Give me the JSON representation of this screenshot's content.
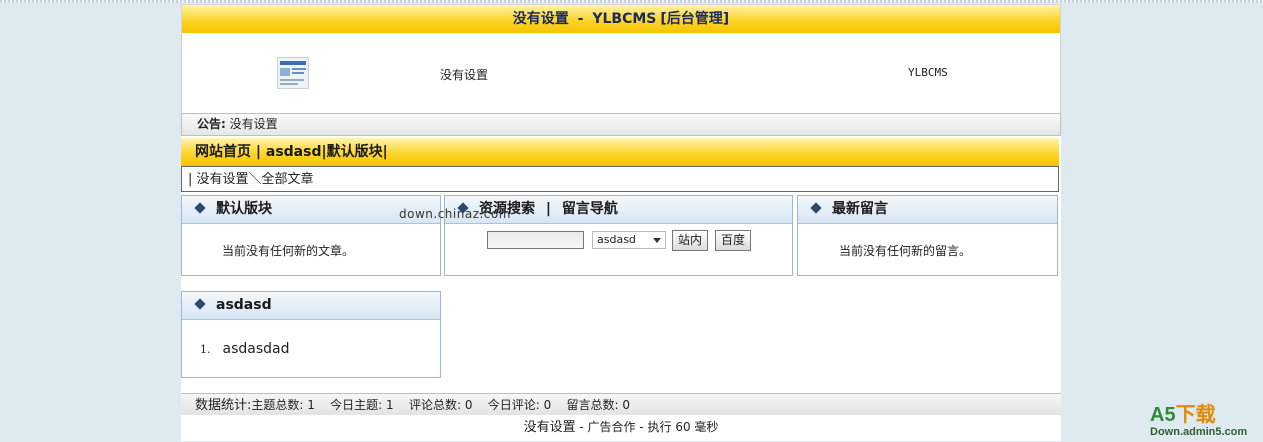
{
  "title": {
    "site_title": "没有设置",
    "separator": " - ",
    "brand": "YLBCMS",
    "suffix": "[后台管理]"
  },
  "header": {
    "site_name": "没有设置",
    "site_brand": "YLBCMS"
  },
  "notice": {
    "label": "公告:",
    "text": "没有设置"
  },
  "nav": {
    "items": [
      "网站首页",
      "asdasd",
      "默认版块"
    ],
    "separator": "|"
  },
  "breadcrumb": {
    "text": "| 没有设置＼全部文章"
  },
  "panels": {
    "default_board": {
      "title": "默认版块",
      "empty_text": "当前没有任何新的文章。"
    },
    "search": {
      "title_a": "资源搜索",
      "title_sep": "|",
      "title_b": "留言导航",
      "input_value": "",
      "select_value": "asdasd",
      "btn_site": "站内",
      "btn_baidu": "百度"
    },
    "latest_messages": {
      "title": "最新留言",
      "empty_text": "当前没有任何新的留言。"
    },
    "asdasd": {
      "title": "asdasd",
      "items": [
        {
          "num": "1.",
          "label": "asdasdad"
        }
      ]
    }
  },
  "watermark": "down.chinaz.com",
  "stats": {
    "label": "数据统计:",
    "topics_label": "主题总数:",
    "topics": "1",
    "today_topics_label": "今日主题:",
    "today_topics": "1",
    "comments_label": "评论总数:",
    "comments": "0",
    "today_comments_label": "今日评论:",
    "today_comments": "0",
    "messages_label": "留言总数:",
    "messages": "0"
  },
  "footer": {
    "site": "没有设置",
    "ad": " - 广告合作 - 执行 ",
    "ms": "60",
    "unit": " 毫秒"
  },
  "badge": {
    "line1_a": "A5",
    "line1_b": "下载",
    "line2": "Down.admin5.com"
  },
  "colors": {
    "yellow_bar": "#fcd42a",
    "title_text": "#1c2a60",
    "panel_head": "#d6e6f3",
    "diamond": "#2e4a6e",
    "page_bg": "#dfe9f0"
  }
}
